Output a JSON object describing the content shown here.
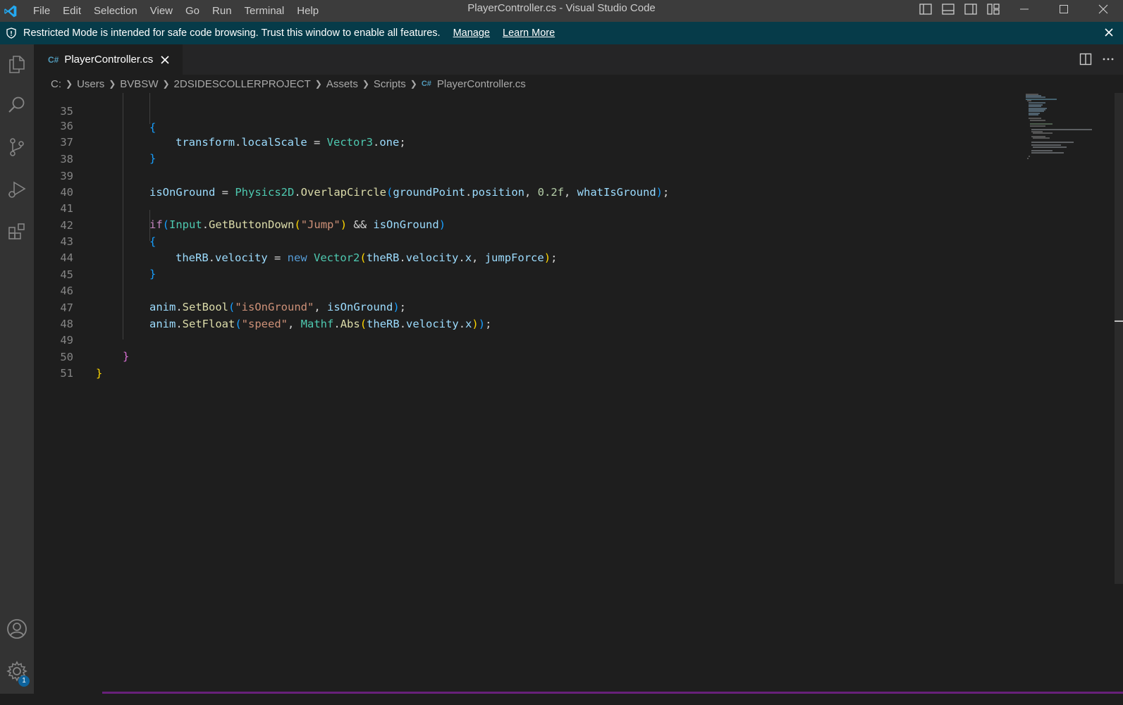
{
  "window": {
    "title": "PlayerController.cs - Visual Studio Code",
    "menu": [
      "File",
      "Edit",
      "Selection",
      "View",
      "Go",
      "Run",
      "Terminal",
      "Help"
    ]
  },
  "banner": {
    "message": "Restricted Mode is intended for safe code browsing. Trust this window to enable all features.",
    "manage": "Manage",
    "learn_more": "Learn More"
  },
  "activity_bar": {
    "items": [
      "explorer-icon",
      "search-icon",
      "source-control-icon",
      "run-debug-icon",
      "extensions-icon"
    ],
    "bottom": [
      "account-icon",
      "manage-gear-icon"
    ],
    "settings_badge": "1"
  },
  "tab": {
    "label": "PlayerController.cs",
    "icon": "C#"
  },
  "breadcrumb": [
    "C:",
    "Users",
    "BVBSW",
    "2DSIDESCOLLERPROJECT",
    "Assets",
    "Scripts",
    "PlayerController.cs"
  ],
  "editor": {
    "line_numbers": [
      "35",
      "36",
      "37",
      "38",
      "39",
      "40",
      "41",
      "42",
      "43",
      "44",
      "45",
      "46",
      "47",
      "48",
      "49",
      "50",
      "51"
    ],
    "code": {
      "l35": "{",
      "l36a": "transform",
      "l36b": ".",
      "l36c": "localScale",
      "l36d": " = ",
      "l36e": "Vector3",
      "l36f": ".",
      "l36g": "one",
      "l36h": ";",
      "l37": "}",
      "l39a": "isOnGround",
      "l39b": " = ",
      "l39c": "Physics2D",
      "l39d": ".",
      "l39e": "OverlapCircle",
      "l39f": "(",
      "l39g": "groundPoint",
      "l39h": ".",
      "l39i": "position",
      "l39j": ", ",
      "l39k": "0.2f",
      "l39l": ", ",
      "l39m": "whatIsGround",
      "l39n": ")",
      "l39o": ";",
      "l41a": "if",
      "l41b": "(",
      "l41c": "Input",
      "l41d": ".",
      "l41e": "GetButtonDown",
      "l41f": "(",
      "l41g": "\"Jump\"",
      "l41h": ")",
      "l41i": " && ",
      "l41j": "isOnGround",
      "l41k": ")",
      "l42": "{",
      "l43a": "theRB",
      "l43b": ".",
      "l43c": "velocity",
      "l43d": " = ",
      "l43e": "new",
      "l43f": " ",
      "l43g": "Vector2",
      "l43h": "(",
      "l43i": "theRB",
      "l43j": ".",
      "l43k": "velocity",
      "l43l": ".",
      "l43m": "x",
      "l43n": ", ",
      "l43o": "jumpForce",
      "l43p": ")",
      "l43q": ";",
      "l44": "}",
      "l46a": "anim",
      "l46b": ".",
      "l46c": "SetBool",
      "l46d": "(",
      "l46e": "\"isOnGround\"",
      "l46f": ", ",
      "l46g": "isOnGround",
      "l46h": ")",
      "l46i": ";",
      "l47a": "anim",
      "l47b": ".",
      "l47c": "SetFloat",
      "l47d": "(",
      "l47e": "\"speed\"",
      "l47f": ", ",
      "l47g": "Mathf",
      "l47h": ".",
      "l47i": "Abs",
      "l47j": "(",
      "l47k": "theRB",
      "l47l": ".",
      "l47m": "velocity",
      "l47n": ".",
      "l47o": "x",
      "l47p": ")",
      "l47q": ")",
      "l47r": ";",
      "l49": "}",
      "l50": "}"
    }
  },
  "colors": {
    "titlebar": "#3c3c3c",
    "banner": "#063b49",
    "activitybar": "#333333",
    "editor_bg": "#1e1e1e",
    "status_accent": "#68217a"
  }
}
